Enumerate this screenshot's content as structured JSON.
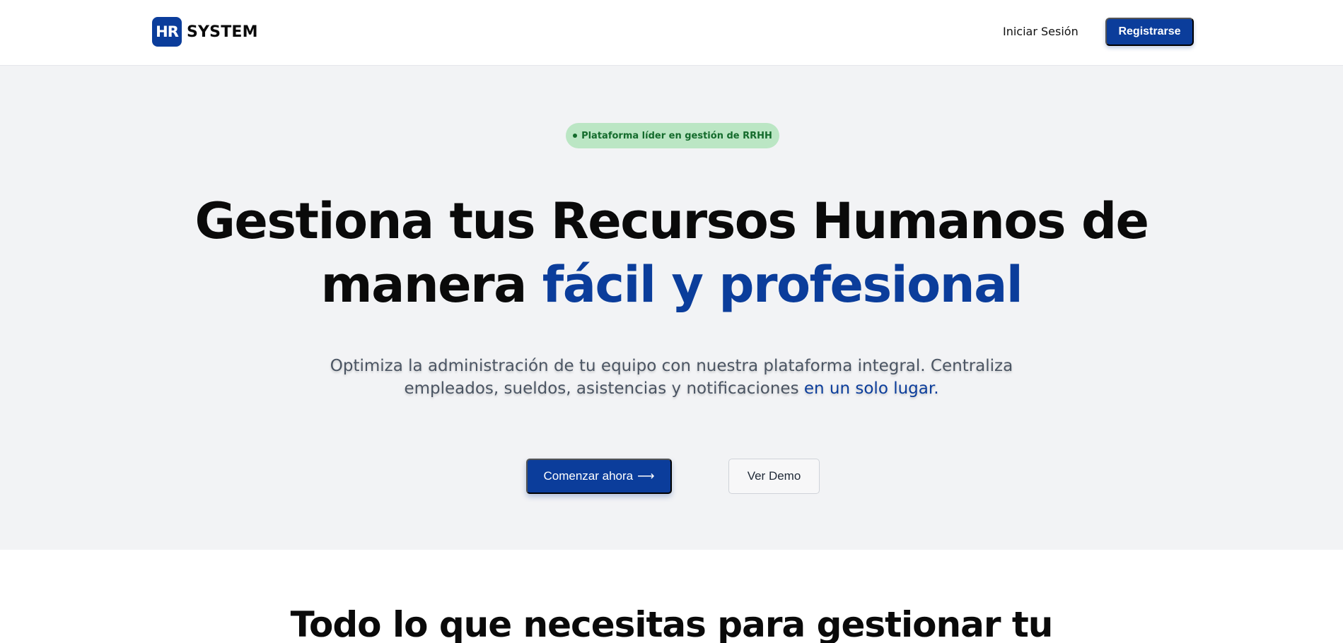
{
  "header": {
    "logo_mark": "HR",
    "brand_name": "SYSTEM",
    "login_label": "Iniciar Sesión",
    "register_label": "Registrarse"
  },
  "hero": {
    "badge_text": "Plataforma líder en gestión de RRHH",
    "title_line1": "Gestiona tus Recursos Humanos de",
    "title_line2_plain": "manera",
    "title_line2_accent": "fácil y profesional",
    "subtitle_plain": "Optimiza la administración de tu equipo con nuestra plataforma integral. Centraliza empleados, sueldos, asistencias y notificaciones",
    "subtitle_accent": "en un solo lugar.",
    "cta_primary_label": "Comenzar ahora",
    "cta_primary_arrow": "⟶",
    "cta_secondary_label": "Ver Demo"
  },
  "features": {
    "title": "Todo lo que necesitas para gestionar tu"
  },
  "colors": {
    "brand_blue": "#0b3d9b",
    "hero_background": "#f2f3f5",
    "badge_background": "#bbe6c4",
    "badge_text": "#146b2c"
  }
}
